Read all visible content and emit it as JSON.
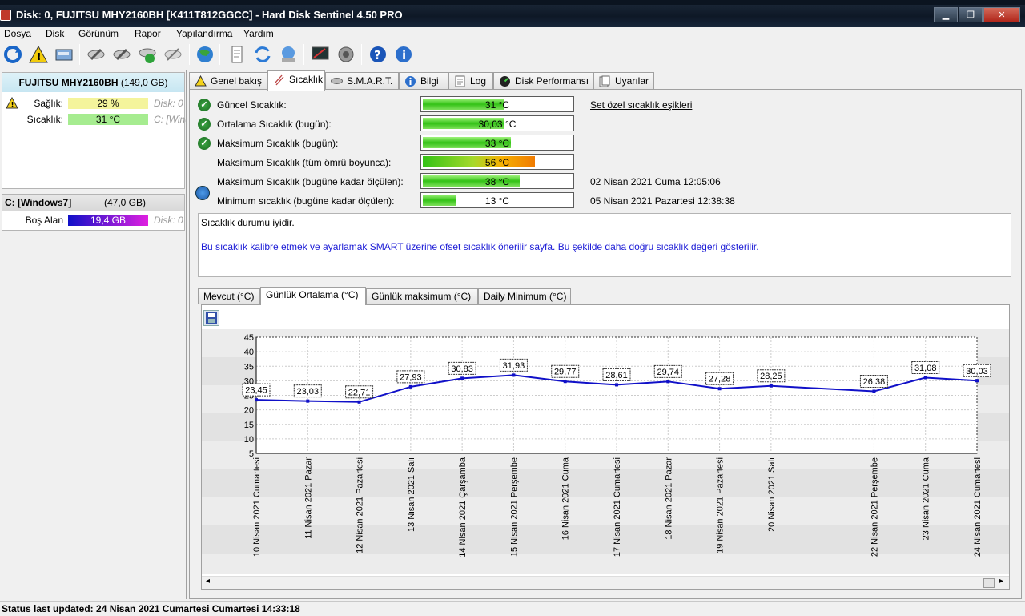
{
  "window": {
    "title": "Disk:  0, FUJITSU MHY2160BH [K411T812GGCC]  -  Hard Disk Sentinel  4.50 PRO"
  },
  "menu": [
    "Dosya",
    "Disk",
    "Görünüm",
    "Rapor",
    "Yapılandırma",
    "Yardım"
  ],
  "toolbar_icons": [
    "refresh-icon",
    "alert-icon",
    "disk-icon",
    "disk-settings-icon",
    "disk-test-icon",
    "disk-ok-icon",
    "disk-tool-icon",
    "globe-icon",
    "report-icon",
    "sync-icon",
    "network-icon",
    "monitor-icon",
    "sound-icon",
    "help-icon",
    "info-icon"
  ],
  "left": {
    "disk_name": "FUJITSU MHY2160BH",
    "disk_size": "(149,0 GB)",
    "health_label": "Sağlık:",
    "health_value": "29 %",
    "health_right": "Disk: 0",
    "health_pct": 29,
    "temp_label": "Sıcaklık:",
    "temp_value": "31 °C",
    "temp_right": "C: [Windows7]",
    "partition_name": "C: [Windows7]",
    "partition_size": "(47,0 GB)",
    "free_label": "Boş Alan",
    "free_value": "19,4 GB",
    "free_right": "Disk: 0",
    "colors": {
      "health": "#f4f49c",
      "temp": "#a6ec90",
      "free": "#1010c8",
      "free_end": "#e020e0"
    }
  },
  "tabs": [
    {
      "label": "Genel bakış",
      "icon": "warning-icon"
    },
    {
      "label": "Sıcaklık",
      "icon": "thermometer-icon"
    },
    {
      "label": "S.M.A.R.T.",
      "icon": "smart-icon"
    },
    {
      "label": "Bilgi",
      "icon": "info-icon"
    },
    {
      "label": "Log",
      "icon": "log-icon"
    },
    {
      "label": "Disk Performansı",
      "icon": "performance-icon"
    },
    {
      "label": "Uyarılar",
      "icon": "alerts-icon"
    }
  ],
  "temps": [
    {
      "label": "Güncel Sıcaklık:",
      "value": "31 °C",
      "fill": 0.55,
      "note": "Set özel sıcaklık eşikleri",
      "ok": true
    },
    {
      "label": "Ortalama Sıcaklık (bugün):",
      "value": "30,03 °C",
      "fill": 0.55,
      "note": "",
      "ok": true
    },
    {
      "label": "Maksimum Sıcaklık (bugün):",
      "value": "33 °C",
      "fill": 0.59,
      "note": "",
      "ok": true
    },
    {
      "label": "Maksimum Sıcaklık (tüm ömrü boyunca):",
      "value": "56 °C",
      "fill": 0.75,
      "note": "",
      "ok": false
    },
    {
      "label": "Maksimum Sıcaklık (bugüne kadar ölçülen):",
      "value": "38 °C",
      "fill": 0.65,
      "note": "02 Nisan 2021 Cuma 12:05:06",
      "ok": false
    },
    {
      "label": "Minimum sıcaklık (bugüne kadar ölçülen):",
      "value": "13 °C",
      "fill": 0.22,
      "note": "05 Nisan 2021 Pazartesi 12:38:38",
      "ok": false
    }
  ],
  "info": {
    "line1": "Sıcaklık durumu iyidir.",
    "line2": "Bu sıcaklık kalibre etmek ve ayarlamak SMART üzerine ofset sıcaklık önerilir sayfa. Bu şekilde daha doğru sıcaklık değeri gösterilir."
  },
  "chart_tabs": [
    "Mevcut  (°C)",
    "Günlük Ortalama  (°C)",
    "Günlük maksimum  (°C)",
    "Daily Minimum (°C)"
  ],
  "chart_data": {
    "type": "line",
    "x": [
      "10 Nisan 2021 Cumartesi",
      "11 Nisan 2021 Pazar",
      "12 Nisan 2021 Pazartesi",
      "13 Nisan 2021 Salı",
      "14 Nisan 2021 Çarşamba",
      "15 Nisan 2021 Perşembe",
      "16 Nisan 2021 Cuma",
      "17 Nisan 2021 Cumartesi",
      "18 Nisan 2021 Pazar",
      "19 Nisan 2021 Pazartesi",
      "20 Nisan 2021 Salı",
      "22 Nisan 2021 Perşembe",
      "23 Nisan 2021 Cuma",
      "24 Nisan 2021 Cumartesi"
    ],
    "day_index": [
      10,
      11,
      12,
      13,
      14,
      15,
      16,
      17,
      18,
      19,
      20,
      22,
      23,
      24
    ],
    "values": [
      23.45,
      23.03,
      22.71,
      27.93,
      30.83,
      31.93,
      29.77,
      28.61,
      29.74,
      27.28,
      28.25,
      26.38,
      31.08,
      30.03
    ],
    "labels": [
      "23,45",
      "23,03",
      "22,71",
      "27,93",
      "30,83",
      "31,93",
      "29,77",
      "28,61",
      "29,74",
      "27,28",
      "28,25",
      "26,38",
      "31,08",
      "30,03"
    ],
    "yticks": [
      5,
      10,
      15,
      20,
      25,
      30,
      35,
      40,
      45
    ],
    "ylim": [
      5,
      45
    ],
    "line_color": "#1010c8"
  },
  "status": "Status last updated: 24 Nisan 2021 Cumartesi Cumartesi 14:33:18"
}
